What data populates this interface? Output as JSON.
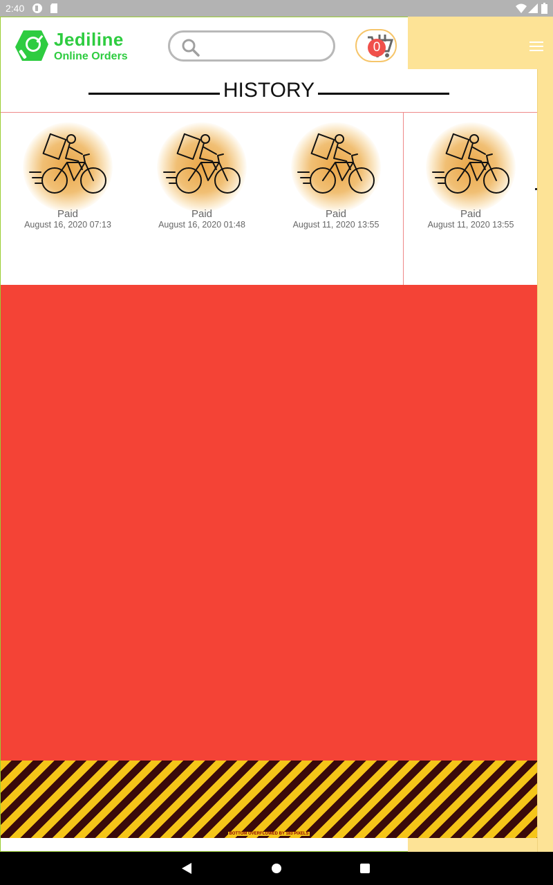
{
  "status_bar": {
    "time": "2:40",
    "icons": [
      "app-notification-icon",
      "sd-card-icon",
      "wifi-icon",
      "signal-icon",
      "battery-icon"
    ]
  },
  "header": {
    "brand_name": "Jediline",
    "brand_subtitle": "Online Orders",
    "search": {
      "value": "",
      "placeholder": ""
    },
    "cart": {
      "count": "0"
    },
    "menu_icon": "hamburger-icon"
  },
  "history": {
    "title": "HISTORY",
    "orders": [
      {
        "status": "Paid",
        "date": "August 16, 2020 07:13",
        "icon": "delivery-bike-icon"
      },
      {
        "status": "Paid",
        "date": "August 16, 2020 01:48",
        "icon": "delivery-bike-icon"
      },
      {
        "status": "Paid",
        "date": "August 11, 2020 13:55",
        "icon": "delivery-bike-icon"
      },
      {
        "status": "Paid",
        "date": "August 11, 2020 13:55",
        "icon": "delivery-bike-icon"
      }
    ]
  },
  "overflow_warning": "BOTTOM OVERFLOWED BY 183 PIXELS",
  "colors": {
    "brand": "#2ecc40",
    "accent_panel": "#fde396",
    "error_area": "#f44336",
    "badge": "#f0504b"
  }
}
